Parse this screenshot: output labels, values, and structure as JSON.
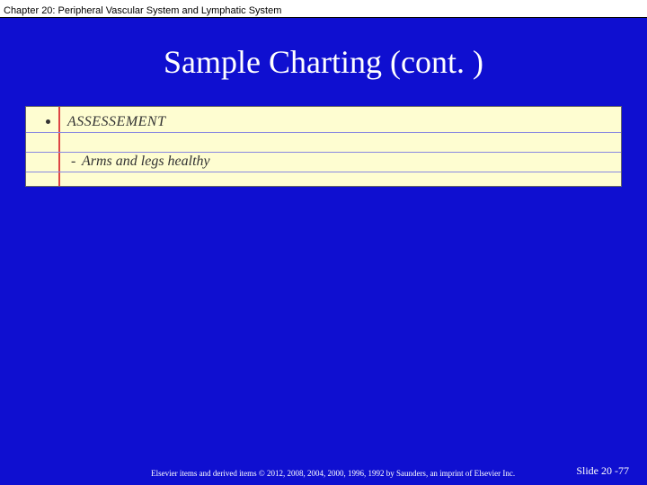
{
  "header": {
    "chapter_text": "Chapter 20: Peripheral Vascular System and Lymphatic System"
  },
  "slide": {
    "title": "Sample Charting (cont. )"
  },
  "note": {
    "section_label": "ASSESSEMENT",
    "dash": "-",
    "content": "Arms and legs healthy"
  },
  "footer": {
    "copyright": "Elsevier items and derived items © 2012, 2008, 2004, 2000, 1996, 1992 by Saunders, an imprint of Elsevier Inc.",
    "slide_number": "Slide 20 -77"
  }
}
